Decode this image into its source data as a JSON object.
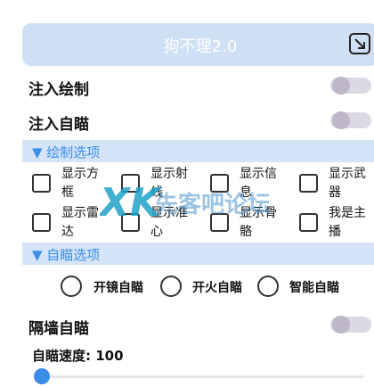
{
  "header": {
    "title": "狗不理2.0",
    "close_icon": "arrow-down-right-box-icon"
  },
  "toggles": [
    {
      "label": "注入绘制",
      "checked": false
    },
    {
      "label": "注入自瞄",
      "checked": false
    }
  ],
  "sections": {
    "draw": "▼ 绘制选项",
    "aim": "▼ 自瞄选项"
  },
  "checkboxes": [
    {
      "label": "显示方框",
      "checked": false
    },
    {
      "label": "显示射线",
      "checked": false
    },
    {
      "label": "显示信息",
      "checked": false
    },
    {
      "label": "显示武器",
      "checked": false
    },
    {
      "label": "显示雷达",
      "checked": false
    },
    {
      "label": "显示准心",
      "checked": false
    },
    {
      "label": "显示骨骼",
      "checked": false
    },
    {
      "label": "我是主播",
      "checked": false
    }
  ],
  "aim_modes": [
    {
      "label": "开镜自瞄",
      "selected": false
    },
    {
      "label": "开火自瞄",
      "selected": false
    },
    {
      "label": "智能自瞄",
      "selected": false
    }
  ],
  "wall_aim": {
    "label": "隔墙自瞄",
    "checked": false
  },
  "speed": {
    "label": "自瞄速度: 100",
    "value": 100
  },
  "watermark": {
    "text": "先客吧论坛",
    "logo": "XK"
  },
  "colors": {
    "accent": "#3a8ee8",
    "header_bg": "#cfe0f5",
    "section_bg": "#d5e4f7"
  }
}
